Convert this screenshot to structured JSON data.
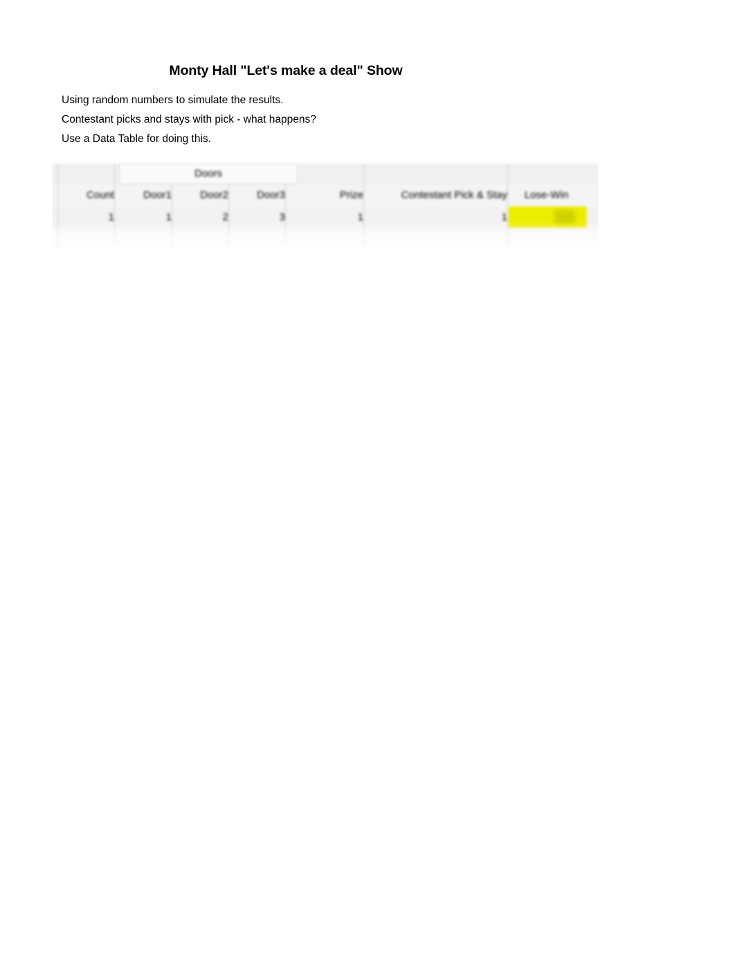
{
  "document": {
    "title": "Monty Hall \"Let's make a deal\" Show",
    "description_lines": [
      "Using random numbers to simulate the results.",
      "Contestant picks and stays with pick - what happens?",
      "Use a Data Table for doing this."
    ]
  },
  "table": {
    "group_header": "Doors",
    "columns": [
      "Count",
      "Door1",
      "Door2",
      "Door3",
      "Prize",
      "Contestant Pick & Stay",
      "Lose-Win"
    ],
    "rows": [
      {
        "count": "1",
        "door1": "1",
        "door2": "2",
        "door3": "3",
        "prize": "1",
        "contestant_pick_and_stay": "1",
        "lose_win": ""
      }
    ],
    "highlight_color": "#eded00"
  }
}
